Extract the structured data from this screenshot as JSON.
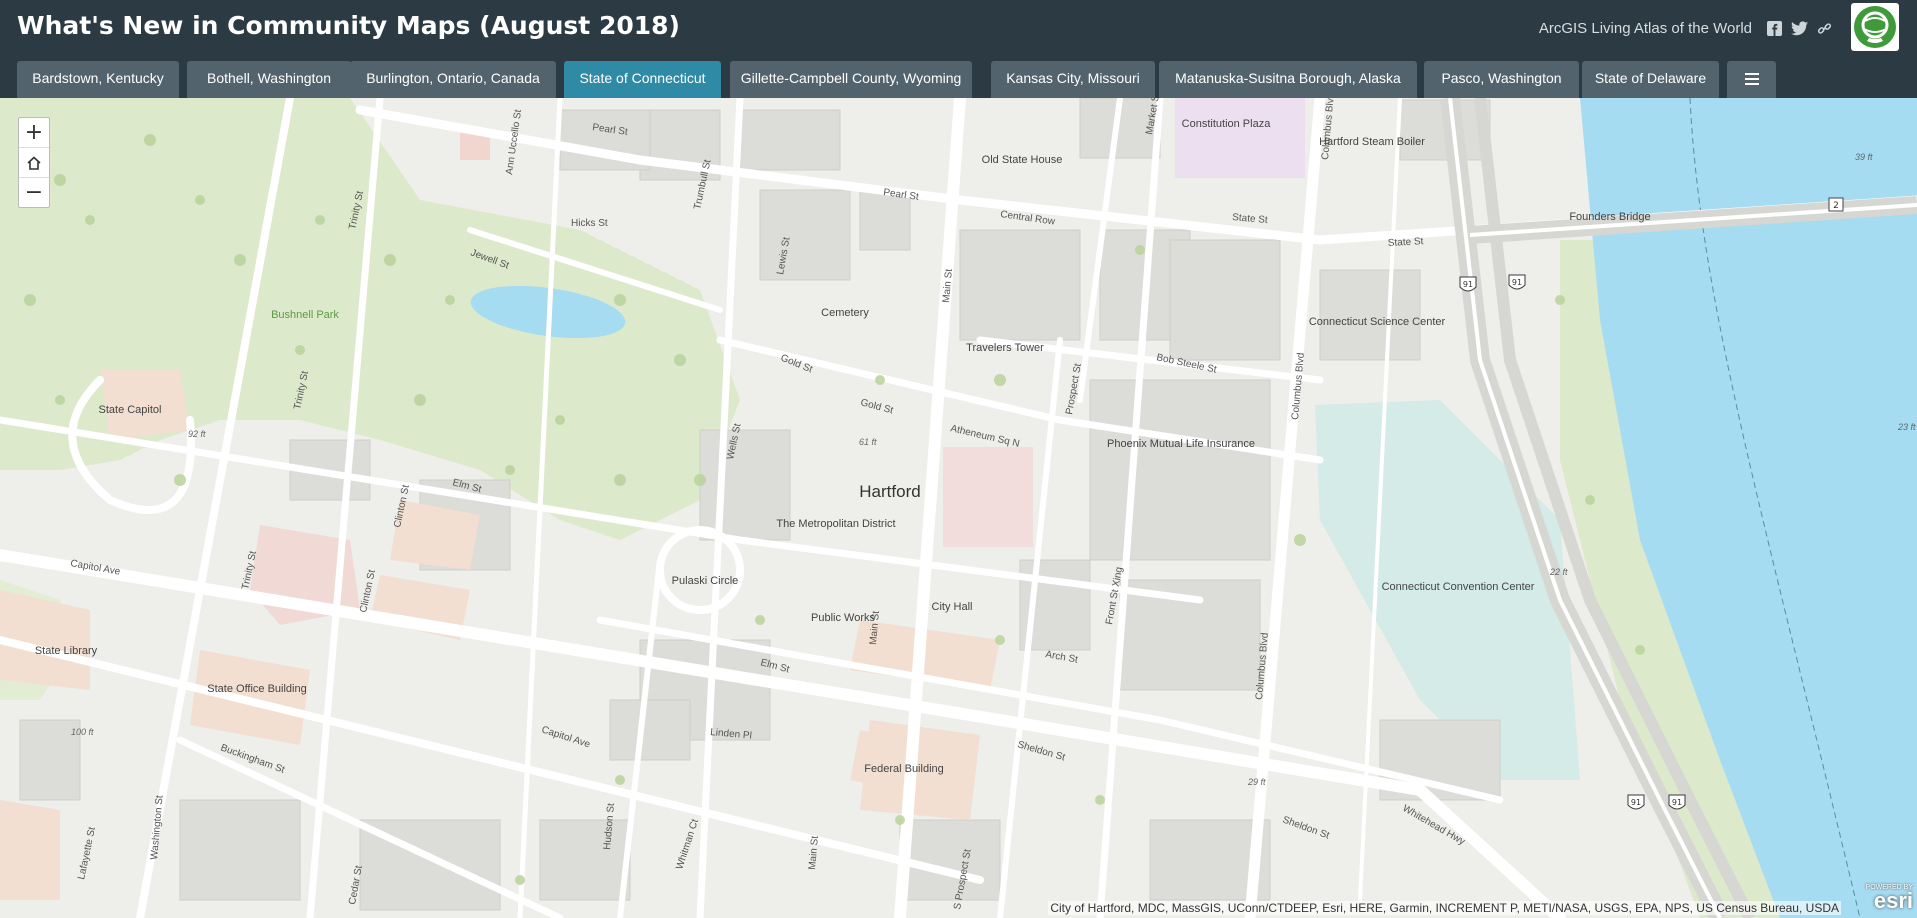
{
  "header": {
    "title": "What's New in Community Maps (August 2018)",
    "atlas_text": "ArcGIS Living Atlas of the World",
    "icons": [
      "facebook-icon",
      "twitter-icon",
      "link-icon"
    ]
  },
  "tabs": [
    {
      "label": "Bardstown, Kentucky",
      "active": false
    },
    {
      "label": "Bothell, Washington",
      "active": false
    },
    {
      "label": "Burlington, Ontario, Canada",
      "active": false
    },
    {
      "label": "State of Connecticut",
      "active": true
    },
    {
      "label": "Gillette-Campbell County, Wyoming",
      "active": false
    },
    {
      "label": "Kansas City, Missouri",
      "active": false
    },
    {
      "label": "Matanuska-Susitna Borough, Alaska",
      "active": false
    },
    {
      "label": "Pasco, Washington",
      "active": false
    },
    {
      "label": "State of Delaware",
      "active": false
    }
  ],
  "menu_icon": "hamburger-menu-icon",
  "zoom": {
    "in": "+",
    "home_icon": "home-icon",
    "out": "−"
  },
  "map": {
    "city": "Hartford",
    "streets": {
      "pearl_st_1": "Pearl St",
      "pearl_st_2": "Pearl St",
      "ann_uccello": "Ann Uccello St",
      "trumbull": "Trumbull St",
      "market": "Market St",
      "columbus_1": "Columbus Blvd",
      "columbus_2": "Columbus Blvd",
      "columbus_3": "Columbus Blvd",
      "hicks": "Hicks St",
      "lewis": "Lewis St",
      "main_1": "Main St",
      "main_2": "Main St",
      "main_3": "Main St",
      "central_row": "Central Row",
      "state_st_1": "State St",
      "state_st_2": "State St",
      "trinity_1": "Trinity St",
      "trinity_2": "Trinity St",
      "trinity_3": "Trinity St",
      "jewell": "Jewell St",
      "gold_1": "Gold St",
      "gold_2": "Gold St",
      "bob_steele": "Bob Steele St",
      "prospect": "Prospect St",
      "atheneum": "Atheneum Sq N",
      "wells": "Wells St",
      "elm_1": "Elm St",
      "elm_2": "Elm St",
      "clinton_1": "Clinton St",
      "clinton_2": "Clinton St",
      "capitol_ave_1": "Capitol Ave",
      "capitol_ave_2": "Capitol Ave",
      "front": "Front St Xing",
      "arch": "Arch St",
      "linden": "Linden Pl",
      "sheldon_1": "Sheldon St",
      "sheldon_2": "Sheldon St",
      "whitehead": "Whitehead Hwy",
      "buckingham": "Buckingham St",
      "washington": "Washington St",
      "lafayette": "Lafayette St",
      "hudson": "Hudson St",
      "whitman": "Whitman Ct",
      "s_prospect": "S Prospect St",
      "cedar": "Cedar St"
    },
    "places": {
      "constitution_plaza": "Constitution Plaza",
      "old_state_house": "Old State House",
      "steam_boiler": "Hartford Steam Boiler",
      "founders_bridge": "Founders Bridge",
      "bushnell_park": "Bushnell Park",
      "cemetery": "Cemetery",
      "travelers_tower": "Travelers Tower",
      "science_center": "Connecticut Science Center",
      "state_capitol": "State Capitol",
      "phoenix": "Phoenix Mutual Life Insurance",
      "metropolitan": "The Metropolitan District",
      "pulaski": "Pulaski Circle",
      "city_hall": "City Hall",
      "public_works": "Public Works",
      "convention_center": "Connecticut Convention Center",
      "state_library": "State Library",
      "state_office": "State Office Building",
      "federal_building": "Federal Building"
    },
    "elevations": {
      "e39": "39 ft",
      "e23": "23 ft",
      "e92": "92 ft",
      "e61": "61 ft",
      "e22": "22 ft",
      "e100": "100 ft",
      "e29": "29 ft"
    },
    "shields": {
      "i91": "91",
      "r2": "2"
    },
    "attribution": "City of Hartford, MDC, MassGIS, UConn/CTDEEP, Esri, HERE, Garmin, INCREMENT P, METI/NASA, USGS, EPA, NPS, US Census Bureau, USDA",
    "esri_powered": "POWERED BY",
    "esri_logo": "esri"
  },
  "colors": {
    "header_bg": "#2b3a43",
    "tab_bg": "#52636d",
    "tab_active": "#2f8aa5",
    "water": "#a5dcf2",
    "park": "#dde9cb"
  }
}
